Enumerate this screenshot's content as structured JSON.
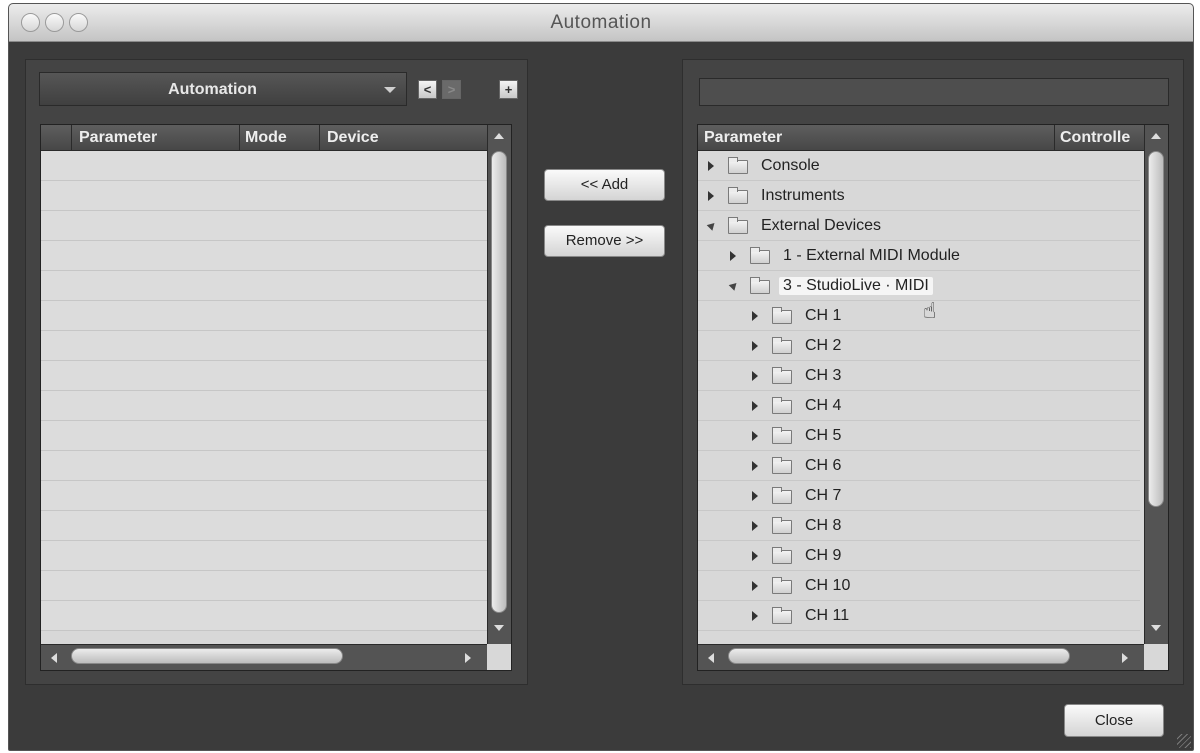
{
  "window": {
    "title": "Automation"
  },
  "left": {
    "dropdown_label": "Automation",
    "prev_label": "<",
    "next_label": ">",
    "add_label": "+",
    "columns": [
      "Parameter",
      "Mode",
      "Device"
    ],
    "row_count": 16
  },
  "middle": {
    "add_button": "<< Add",
    "remove_button": "Remove >>"
  },
  "right": {
    "search_value": "",
    "columns": [
      "Parameter",
      "Controlle"
    ],
    "tree": [
      {
        "label": "Console",
        "level": 0,
        "expanded": false
      },
      {
        "label": "Instruments",
        "level": 0,
        "expanded": false
      },
      {
        "label": "External Devices",
        "level": 0,
        "expanded": true
      },
      {
        "label": "1 - External MIDI Module",
        "level": 1,
        "expanded": false
      },
      {
        "label": "3 - StudioLive · MIDI",
        "level": 1,
        "expanded": true,
        "highlighted": true
      },
      {
        "label": "CH 1",
        "level": 2,
        "expanded": false
      },
      {
        "label": "CH 2",
        "level": 2,
        "expanded": false
      },
      {
        "label": "CH 3",
        "level": 2,
        "expanded": false
      },
      {
        "label": "CH 4",
        "level": 2,
        "expanded": false
      },
      {
        "label": "CH 5",
        "level": 2,
        "expanded": false
      },
      {
        "label": "CH 6",
        "level": 2,
        "expanded": false
      },
      {
        "label": "CH 7",
        "level": 2,
        "expanded": false
      },
      {
        "label": "CH 8",
        "level": 2,
        "expanded": false
      },
      {
        "label": "CH 9",
        "level": 2,
        "expanded": false
      },
      {
        "label": "CH 10",
        "level": 2,
        "expanded": false
      },
      {
        "label": "CH 11",
        "level": 2,
        "expanded": false
      }
    ]
  },
  "footer": {
    "close_button": "Close"
  },
  "icons": {
    "close": "window-close-icon",
    "minimize": "window-minimize-icon",
    "zoom": "window-zoom-icon",
    "folder": "folder-icon",
    "cursor": "hand-pointer-icon"
  }
}
